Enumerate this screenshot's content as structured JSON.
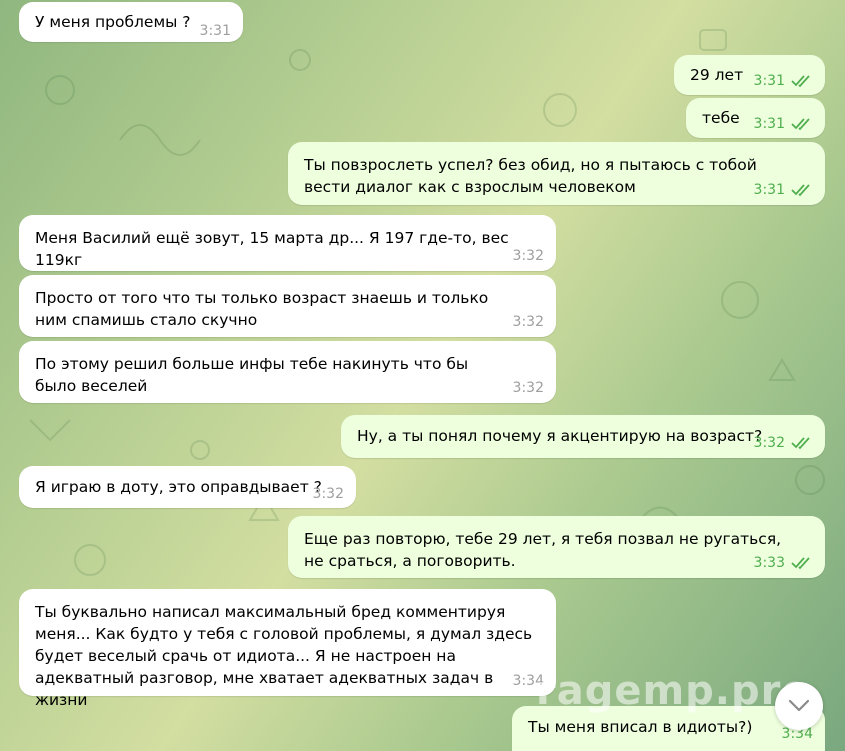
{
  "messages": [
    {
      "text": "У меня проблемы ?",
      "time": "3:31",
      "dir": "in"
    },
    {
      "text": "29 лет",
      "time": "3:31",
      "dir": "out"
    },
    {
      "text": "тебе",
      "time": "3:31",
      "dir": "out"
    },
    {
      "text": "Ты повзрослеть успел? без обид, но я пытаюсь с тобой вести диалог как с взрослым человеком",
      "time": "3:31",
      "dir": "out"
    },
    {
      "text": "Меня Василий ещё зовут, 15 марта др... Я 197 где-то, вес 119кг",
      "time": "3:32",
      "dir": "in"
    },
    {
      "text": "Просто от того что ты только возраст знаешь и только ним спамишь стало скучно",
      "time": "3:32",
      "dir": "in"
    },
    {
      "text": "По этому решил больше инфы тебе накинуть что бы было веселей",
      "time": "3:32",
      "dir": "in"
    },
    {
      "text": "Ну, а ты понял почему я акцентирую на возраст?",
      "time": "3:32",
      "dir": "out"
    },
    {
      "text": "Я играю в доту, это оправдывает ?",
      "time": "3:32",
      "dir": "in"
    },
    {
      "text": "Еще раз повторю, тебе 29 лет, я тебя позвал не ругаться, не сраться, а поговорить.",
      "time": "3:33",
      "dir": "out"
    },
    {
      "text": "Ты буквально написал максимальный бред комментируя меня... Как будто у тебя с головой проблемы, я думал здесь будет веселый срачь от идиота... Я не настроен на адекватный разговор, мне хватает адекватных задач в жизни",
      "time": "3:34",
      "dir": "in"
    },
    {
      "text": "Ты меня вписал в идиоты?)",
      "time": "3:34",
      "dir": "out"
    }
  ],
  "watermark": "ragemp.pro",
  "icons": {
    "read_receipt": "double-check-icon",
    "scroll_down": "chevron-down-icon"
  },
  "colors": {
    "incoming_bubble": "#ffffff",
    "outgoing_bubble": "#eeffde",
    "read_check": "#4fae4e",
    "time_gray": "#9e9e9e"
  }
}
